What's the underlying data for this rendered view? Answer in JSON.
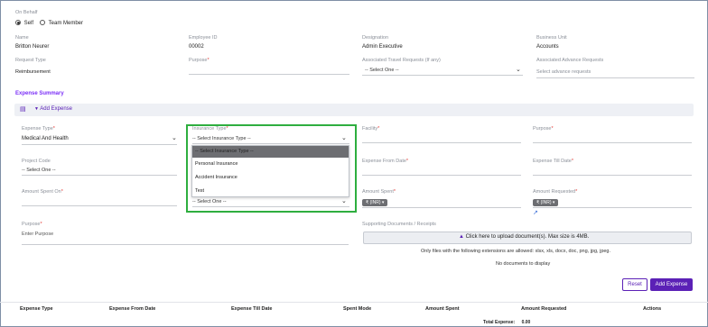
{
  "on_behalf": {
    "label": "On Behalf",
    "options": [
      "Self",
      "Team Member"
    ],
    "selected": "Self"
  },
  "employee": {
    "name_label": "Name",
    "name_value": "Britton Neurer",
    "id_label": "Employee ID",
    "id_value": "00002",
    "designation_label": "Designation",
    "designation_value": "Admin Executive",
    "bu_label": "Business Unit",
    "bu_value": "Accounts"
  },
  "request": {
    "type_label": "Request Type",
    "type_value": "Reimbursement",
    "purpose_label": "Purpose",
    "travel_label": "Associated Travel Requests (If any)",
    "travel_value": "-- Select One --",
    "advance_label": "Associated Advance Requests",
    "advance_placeholder": "Select advance requests"
  },
  "expense_summary": {
    "title": "Expense Summary",
    "add_label": "Add Expense"
  },
  "form": {
    "expense_type_label": "Expense Type",
    "expense_type_value": "Medical And Health",
    "insurance_type_label": "Insurance Type",
    "insurance_type_value": "-- Select Insurance Type --",
    "facility_label": "Facility",
    "purpose_label": "Purpose",
    "project_code_label": "Project Code",
    "project_code_value": "-- Select One --",
    "from_date_label": "Expense From Date",
    "till_date_label": "Expense Till Date",
    "spent_on_label": "Amount Spent On",
    "spent_on_value": "-- Select One --",
    "amount_spent_label": "Amount Spent",
    "amount_spent_currency": "₹ (INR)",
    "amount_requested_label": "Amount Requested",
    "amount_requested_currency": "₹ (INR)",
    "purpose2_label": "Purpose",
    "purpose2_placeholder": "Enter Purpose",
    "docs_label": "Supporting Documents / Receipts",
    "upload_label": "Click here to upload document(s). Max size is 4MB.",
    "extensions_note": "Only files with the following extensions are allowed: xlsx, xls, docx, doc, png, jpg, jpeg.",
    "no_docs": "No documents to display"
  },
  "insurance_dropdown": {
    "options": [
      "-- Select Insurance Type --",
      "Personal Insurance",
      "Accident Insurance",
      "Test"
    ],
    "highlighted": 0
  },
  "buttons": {
    "reset": "Reset",
    "add_expense": "Add Expense"
  },
  "table": {
    "headers": [
      "Expense Type",
      "Expense From Date",
      "Expense Till Date",
      "Spent Mode",
      "Amount Spent",
      "Amount Requested",
      "Actions"
    ],
    "total_label": "Total Expense:",
    "total_value": "0.00"
  },
  "colors": {
    "accent": "#5b21b6",
    "highlight_box": "#2eae3f"
  }
}
